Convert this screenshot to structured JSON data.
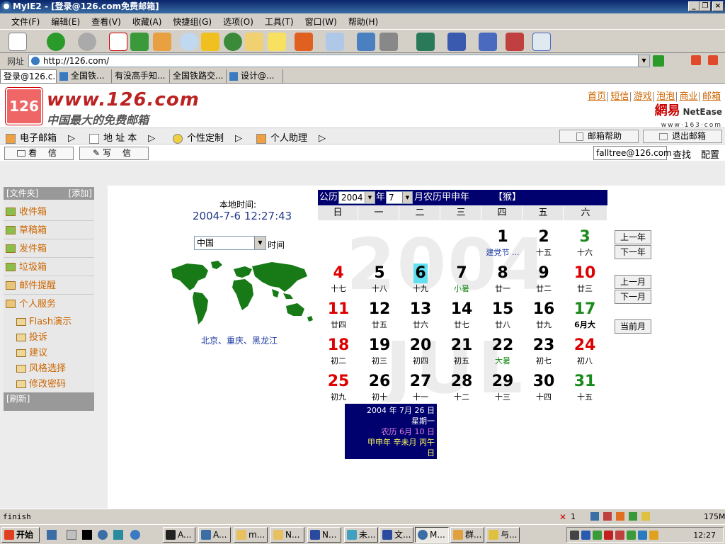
{
  "window": {
    "title": "MyIE2 - [登录@126.com免费邮箱]"
  },
  "menu": [
    "文件(F)",
    "编辑(E)",
    "查看(V)",
    "收藏(A)",
    "快捷组(G)",
    "选项(O)",
    "工具(T)",
    "窗口(W)",
    "帮助(H)"
  ],
  "address": {
    "label": "网址",
    "url": "http://126.com/"
  },
  "tabs": [
    "登录@126.c...",
    "全国铁...",
    "有没高手知...",
    "全国铁路交...",
    "设计@..."
  ],
  "header": {
    "logo_text": "126",
    "site": "www.126.com",
    "slogan": "中国最大的免费邮箱",
    "links": [
      "首页",
      "短信",
      "游戏",
      "泡泡",
      "商业",
      "邮箱"
    ],
    "brand_cn": "網易",
    "brand_en": "NetEase",
    "brand_domain": "www·163·com"
  },
  "nav": {
    "items": [
      "电子邮箱",
      "地 址 本",
      "个性定制",
      "个人助理"
    ],
    "help_btn": "邮箱帮助",
    "logout_btn": "退出邮箱"
  },
  "sub": {
    "read": "看 信",
    "write": "写 信",
    "email": "falltree@126.com",
    "search": "查找",
    "config": "配置"
  },
  "sidebar": {
    "header": "[文件夹]",
    "add": "[添加]",
    "folders": [
      "收件箱",
      "草稿箱",
      "发件箱",
      "垃圾箱",
      "邮件提醒",
      "个人服务"
    ],
    "subs": [
      "Flash演示",
      "投诉",
      "建议",
      "风格选择",
      "修改密码"
    ],
    "refresh": "[刷新]"
  },
  "clock": {
    "label": "本地时间:",
    "time": "2004-7-6 12:27:43",
    "country": "中国",
    "time_label": "时间",
    "cities": "北京、重庆、黑龙江"
  },
  "calendar": {
    "gongli": "公历",
    "year": "2004",
    "nian": "年",
    "month": "7",
    "yue_nongli": "月农历甲申年",
    "zodiac": "【猴】",
    "weekdays": [
      "日",
      "一",
      "二",
      "三",
      "四",
      "五",
      "六"
    ],
    "bg_year": "2004",
    "bg_month": "JUL",
    "days": [
      {
        "d": "1",
        "l": "建党节 ...",
        "col": 4,
        "row": 0,
        "color": "#000000",
        "lcolor": "#1a3aa0"
      },
      {
        "d": "2",
        "l": "十五",
        "col": 5,
        "row": 0,
        "color": "#000000",
        "lcolor": "#000000"
      },
      {
        "d": "3",
        "l": "十六",
        "col": 6,
        "row": 0,
        "color": "#1a8a1a",
        "lcolor": "#000000"
      },
      {
        "d": "4",
        "l": "十七",
        "col": 0,
        "row": 1,
        "color": "#dd0000",
        "lcolor": "#000000"
      },
      {
        "d": "5",
        "l": "十八",
        "col": 1,
        "row": 1,
        "color": "#000000",
        "lcolor": "#000000"
      },
      {
        "d": "6",
        "l": "十九",
        "col": 2,
        "row": 1,
        "color": "#000000",
        "lcolor": "#000000",
        "today": true
      },
      {
        "d": "7",
        "l": "小暑",
        "col": 3,
        "row": 1,
        "color": "#000000",
        "lcolor": "#1a8a1a"
      },
      {
        "d": "8",
        "l": "廿一",
        "col": 4,
        "row": 1,
        "color": "#000000",
        "lcolor": "#000000"
      },
      {
        "d": "9",
        "l": "廿二",
        "col": 5,
        "row": 1,
        "color": "#000000",
        "lcolor": "#000000"
      },
      {
        "d": "10",
        "l": "廿三",
        "col": 6,
        "row": 1,
        "color": "#dd0000",
        "lcolor": "#000000"
      },
      {
        "d": "11",
        "l": "廿四",
        "col": 0,
        "row": 2,
        "color": "#dd0000",
        "lcolor": "#000000"
      },
      {
        "d": "12",
        "l": "廿五",
        "col": 1,
        "row": 2,
        "color": "#000000",
        "lcolor": "#000000"
      },
      {
        "d": "13",
        "l": "廿六",
        "col": 2,
        "row": 2,
        "color": "#000000",
        "lcolor": "#000000"
      },
      {
        "d": "14",
        "l": "廿七",
        "col": 3,
        "row": 2,
        "color": "#000000",
        "lcolor": "#000000"
      },
      {
        "d": "15",
        "l": "廿八",
        "col": 4,
        "row": 2,
        "color": "#000000",
        "lcolor": "#000000"
      },
      {
        "d": "16",
        "l": "廿九",
        "col": 5,
        "row": 2,
        "color": "#000000",
        "lcolor": "#000000"
      },
      {
        "d": "17",
        "l": "6月大",
        "col": 6,
        "row": 2,
        "color": "#1a8a1a",
        "lcolor": "#000000",
        "lbold": true
      },
      {
        "d": "18",
        "l": "初二",
        "col": 0,
        "row": 3,
        "color": "#dd0000",
        "lcolor": "#000000"
      },
      {
        "d": "19",
        "l": "初三",
        "col": 1,
        "row": 3,
        "color": "#000000",
        "lcolor": "#000000"
      },
      {
        "d": "20",
        "l": "初四",
        "col": 2,
        "row": 3,
        "color": "#000000",
        "lcolor": "#000000"
      },
      {
        "d": "21",
        "l": "初五",
        "col": 3,
        "row": 3,
        "color": "#000000",
        "lcolor": "#000000"
      },
      {
        "d": "22",
        "l": "大暑",
        "col": 4,
        "row": 3,
        "color": "#000000",
        "lcolor": "#1a8a1a"
      },
      {
        "d": "23",
        "l": "初七",
        "col": 5,
        "row": 3,
        "color": "#000000",
        "lcolor": "#000000"
      },
      {
        "d": "24",
        "l": "初八",
        "col": 6,
        "row": 3,
        "color": "#dd0000",
        "lcolor": "#000000"
      },
      {
        "d": "25",
        "l": "初九",
        "col": 0,
        "row": 4,
        "color": "#dd0000",
        "lcolor": "#000000"
      },
      {
        "d": "26",
        "l": "初十",
        "col": 1,
        "row": 4,
        "color": "#000000",
        "lcolor": "#000000"
      },
      {
        "d": "27",
        "l": "十一",
        "col": 2,
        "row": 4,
        "color": "#000000",
        "lcolor": "#000000"
      },
      {
        "d": "28",
        "l": "十二",
        "col": 3,
        "row": 4,
        "color": "#000000",
        "lcolor": "#000000"
      },
      {
        "d": "29",
        "l": "十三",
        "col": 4,
        "row": 4,
        "color": "#000000",
        "lcolor": "#000000"
      },
      {
        "d": "30",
        "l": "十四",
        "col": 5,
        "row": 4,
        "color": "#000000",
        "lcolor": "#000000"
      },
      {
        "d": "31",
        "l": "十五",
        "col": 6,
        "row": 4,
        "color": "#1a8a1a",
        "lcolor": "#000000"
      }
    ],
    "info": {
      "line1": "2004 年  7月  26 日",
      "line2": "星期一",
      "line3": "农历  6月  10 日",
      "line4": "甲申年  辛未月  丙午",
      "line5": "日"
    },
    "buttons": [
      "上一年",
      "下一年",
      "上一月",
      "下一月",
      "当前月"
    ]
  },
  "status": {
    "text": "finish",
    "count": "1",
    "memory": "175M"
  },
  "taskbar": {
    "start": "开始",
    "tasks": [
      "A...",
      "A...",
      "m...",
      "N...",
      "N...",
      "未...",
      "文...",
      "M...",
      "群...",
      "与..."
    ],
    "clock": "12:27"
  },
  "colors": {
    "calendar_nav": "#00006e",
    "link_orange": "#cc6600",
    "today_highlight": "#60e0f0"
  }
}
